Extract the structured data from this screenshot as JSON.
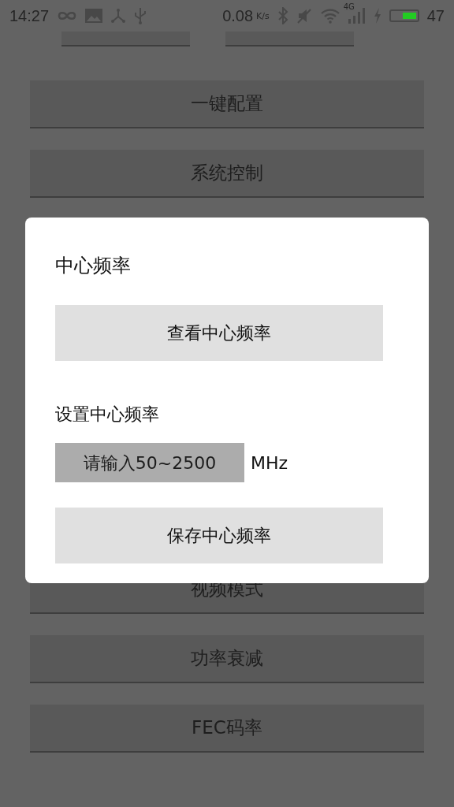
{
  "status_bar": {
    "time": "14:27",
    "speed": "0.08",
    "speed_unit": "K/s",
    "network": "4G",
    "battery": {
      "charging": true
    },
    "battery_text": "47"
  },
  "buttons": [
    {
      "kind": "partial"
    },
    {
      "kind": "partial"
    },
    {
      "label": "一键配置",
      "kind": "full"
    },
    {
      "label": "系统控制",
      "kind": "full"
    },
    {
      "kind": "hidden"
    },
    {
      "label": "视频模式",
      "kind": "full"
    },
    {
      "label": "功率衰减",
      "kind": "full"
    },
    {
      "label": "FEC码率",
      "kind": "full"
    }
  ],
  "dialog": {
    "title": "中心频率",
    "view_button": "查看中心频率",
    "set_label": "设置中心频率",
    "input": {
      "placeholder": "请输入50~2500"
    },
    "unit": "MHz",
    "save_button": "保存中心频率"
  }
}
